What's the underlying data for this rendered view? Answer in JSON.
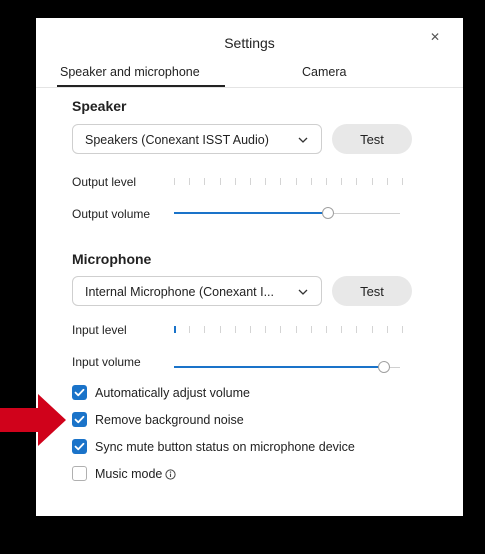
{
  "dialog": {
    "title": "Settings",
    "tabs": [
      {
        "label": "Speaker and microphone",
        "active": true
      },
      {
        "label": "Camera",
        "active": false
      }
    ]
  },
  "speaker": {
    "heading": "Speaker",
    "device": "Speakers (Conexant ISST Audio)",
    "test_label": "Test",
    "output_level_label": "Output level",
    "output_level": 0,
    "output_volume_label": "Output volume",
    "output_volume": 0.68
  },
  "microphone": {
    "heading": "Microphone",
    "device": "Internal Microphone (Conexant I...",
    "test_label": "Test",
    "input_level_label": "Input level",
    "input_level": 1,
    "input_volume_label": "Input volume",
    "input_volume": 0.93
  },
  "options": [
    {
      "label": "Automatically adjust volume",
      "checked": true
    },
    {
      "label": "Remove background noise",
      "checked": true
    },
    {
      "label": "Sync mute button status on microphone device",
      "checked": true
    },
    {
      "label": "Music mode",
      "checked": false
    }
  ],
  "colors": {
    "accent": "#1a73c9",
    "annotation_arrow": "#d0021b"
  }
}
